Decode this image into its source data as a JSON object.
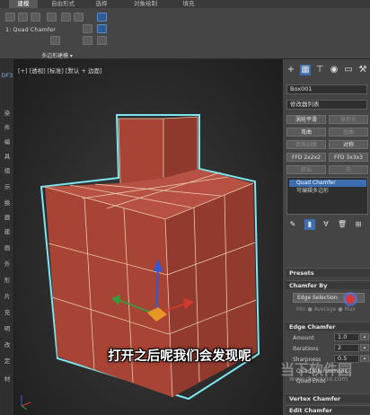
{
  "ribbon": {
    "tabs": [
      "建模",
      "自由形式",
      "选择",
      "对象绘制",
      "填充"
    ],
    "active_tab": 0,
    "modifier_label": "1: Quad Chamfer",
    "section_label": "多边形建模 ▾"
  },
  "left_strip": {
    "items": [
      "DF3",
      "染",
      "件",
      "编",
      "具",
      "组",
      "示",
      "换",
      "器",
      "建",
      "画",
      "外",
      "形",
      "片",
      "充",
      "明",
      "改",
      "定",
      "材"
    ]
  },
  "viewport": {
    "label": "[+] [透视] [标准] [默认明暗处理 + 边面]",
    "label_short": "[+] [透视] [标准] [默认 + 边面]",
    "subtitle": "打开之后呢我们会发现呢"
  },
  "command_panel": {
    "object_name": "Box001",
    "modifier_list": "修改器列表",
    "buttons": [
      {
        "label": "涡轮平滑",
        "dim": false
      },
      {
        "label": "球形化",
        "dim": true
      },
      {
        "label": "弯曲",
        "dim": false
      },
      {
        "label": "扭曲",
        "dim": true
      },
      {
        "label": "倒角剖面",
        "dim": true
      },
      {
        "label": "对称",
        "dim": false
      },
      {
        "label": "FFD 2x2x2",
        "dim": false
      },
      {
        "label": "FFD 3x3x3",
        "dim": false
      },
      {
        "label": "挤出",
        "dim": true
      },
      {
        "label": "壳",
        "dim": true
      }
    ],
    "stack": [
      {
        "label": "Quad Chamfer",
        "selected": true
      },
      {
        "label": "可编辑多边形",
        "selected": false
      }
    ],
    "rollouts": {
      "presets": "Presets",
      "chamfer_by": "Chamfer By",
      "edge_chamfer": "Edge Chamfer",
      "vertex_chamfer": "Vertex Chamfer",
      "edit_chamfer": "Edit Chamfer"
    },
    "chamfer_by_value": "Edge Selection",
    "avg_label": "Min ● Average ● Max",
    "edge_chamfer_fields": [
      {
        "label": "Amount",
        "value": "1.0"
      },
      {
        "label": "Iterations",
        "value": "2"
      },
      {
        "label": "Sharpness",
        "value": "0.5"
      }
    ],
    "checks": [
      "Quad Intersections",
      "Quad Ends"
    ]
  },
  "watermark": {
    "logo_text": "当下软件园",
    "url": "www.downxia.com"
  },
  "colors": {
    "box_fill": "#a84436",
    "box_side": "#8a3529",
    "box_top": "#b85344",
    "wire": "#e8c9b0",
    "selection_outline": "#7ee6f0",
    "accent_blue": "#3b6fb0"
  }
}
